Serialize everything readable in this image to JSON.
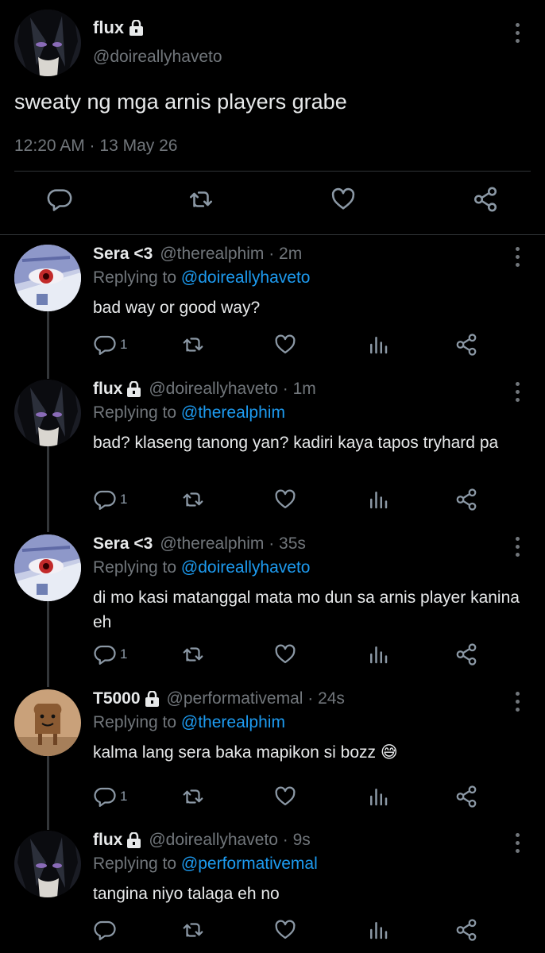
{
  "main_tweet": {
    "name": "flux",
    "handle": "@doireallyhaveto",
    "text": "sweaty ng mga arnis players grabe",
    "timestamp": "12:20 AM · 13 May 26",
    "icons": [
      "reply-icon",
      "retweet-icon",
      "like-icon",
      "share-icon"
    ]
  },
  "replies": [
    {
      "name": "Sera <3",
      "locked": false,
      "meta": "@therealphim · 2m",
      "replying_prefix": "Replying to ",
      "replying_to": "@doireallyhaveto",
      "text": "bad way or good way?",
      "reply_count": "1",
      "avatar": "anime-eye"
    },
    {
      "name": "flux",
      "locked": true,
      "meta": "@doireallyhaveto · 1m",
      "replying_prefix": "Replying to ",
      "replying_to": "@therealphim",
      "text": "bad? klaseng tanong yan? kadiri kaya tapos tryhard pa",
      "reply_count": "1",
      "avatar": "dark-hair"
    },
    {
      "name": "Sera <3",
      "locked": false,
      "meta": "@therealphim · 35s",
      "replying_prefix": "Replying to ",
      "replying_to": "@doireallyhaveto",
      "text": "di mo kasi matanggal mata mo dun sa arnis player kanina eh",
      "reply_count": "1",
      "avatar": "anime-eye"
    },
    {
      "name": "T5000",
      "locked": true,
      "meta": "@performativemal · 24s",
      "replying_prefix": "Replying to ",
      "replying_to": "@therealphim",
      "text": "kalma lang sera baka mapikon si bozz 😅",
      "reply_count": "1",
      "avatar": "toast"
    },
    {
      "name": "flux",
      "locked": true,
      "meta": "@doireallyhaveto · 9s",
      "replying_prefix": "Replying to ",
      "replying_to": "@performativemal",
      "text": "tangina niyo talaga eh no",
      "reply_count": "",
      "avatar": "dark-hair"
    }
  ],
  "colors": {
    "background": "#000000",
    "text": "#e7e9ea",
    "secondary": "#71767b",
    "link": "#1d9bf0",
    "divider": "#2f3336"
  }
}
